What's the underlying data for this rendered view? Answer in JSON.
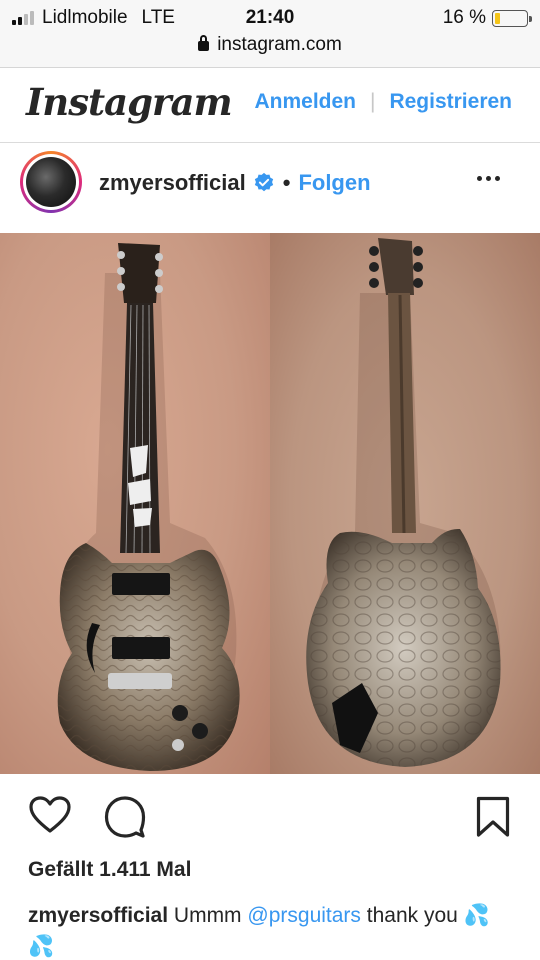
{
  "status_bar": {
    "carrier": "Lidlmobile",
    "network": "LTE",
    "time": "21:40",
    "battery": "16 %",
    "battery_level": 0.16
  },
  "browser": {
    "url": "instagram.com"
  },
  "header": {
    "logo": "Instagram",
    "login_label": "Anmelden",
    "separator": "|",
    "register_label": "Registrieren"
  },
  "post": {
    "username": "zmyersofficial",
    "verified": true,
    "separator": "•",
    "follow_label": "Folgen",
    "likes": "Gefällt 1.411 Mal",
    "caption": {
      "username": "zmyersofficial",
      "text_before": "Ummm",
      "mention": "@prsguitars",
      "text_after": "thank you 💦 💦"
    }
  },
  "colors": {
    "link_blue": "#3897f0",
    "text": "#262626",
    "border": "#dbdbdb"
  },
  "icons": [
    "lock-icon",
    "verified-badge-icon",
    "more-icon",
    "heart-icon",
    "comment-icon",
    "bookmark-icon"
  ]
}
